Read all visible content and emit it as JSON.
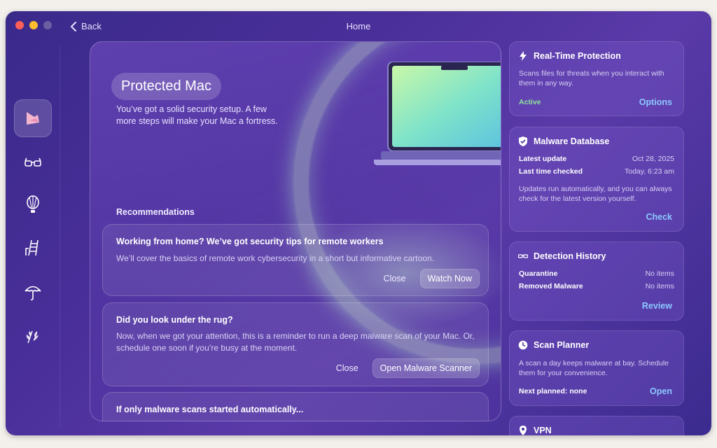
{
  "window": {
    "title": "Home",
    "back_label": "Back"
  },
  "sidebar": {
    "items": [
      {
        "icon": "shield-flag-icon",
        "active": true
      },
      {
        "icon": "glasses-icon"
      },
      {
        "icon": "balloon-icon"
      },
      {
        "icon": "ladder-icon"
      },
      {
        "icon": "umbrella-icon"
      },
      {
        "icon": "leaves-icon"
      }
    ]
  },
  "hero": {
    "title": "Protected Mac",
    "subtitle": "You’ve got a solid security setup. A few more steps will make your Mac a fortress."
  },
  "recommendations": {
    "heading": "Recommendations",
    "items": [
      {
        "title": "Working from home? We’ve got security tips for remote workers",
        "body": "We’ll cover the basics of remote work cybersecurity in a short but informative cartoon.",
        "secondary": "Close",
        "primary": "Watch Now"
      },
      {
        "title": "Did you look under the rug?",
        "body": "Now, when we got your attention, this is a reminder to run a deep malware scan of your Mac. Or, schedule one soon if you’re busy at the moment.",
        "secondary": "Close",
        "primary": "Open Malware Scanner"
      },
      {
        "title": "If only malware scans started automatically..."
      }
    ]
  },
  "cards": {
    "realtime": {
      "title": "Real-Time Protection",
      "desc": "Scans files for threats when you interact with them in any way.",
      "status": "Active",
      "action": "Options"
    },
    "database": {
      "title": "Malware Database",
      "rows": [
        {
          "k": "Latest update",
          "v": "Oct 28, 2025"
        },
        {
          "k": "Last time checked",
          "v": "Today, 6:23 am"
        }
      ],
      "desc": "Updates run automatically, and you can always check for the latest version yourself.",
      "action": "Check"
    },
    "history": {
      "title": "Detection History",
      "rows": [
        {
          "k": "Quarantine",
          "v": "No items"
        },
        {
          "k": "Removed Malware",
          "v": "No items"
        }
      ],
      "action": "Review"
    },
    "planner": {
      "title": "Scan Planner",
      "desc": "A scan a day keeps malware at bay. Schedule them for your convenience.",
      "next": "Next planned: none",
      "action": "Open"
    },
    "vpn": {
      "title": "VPN"
    }
  },
  "colors": {
    "accent_link": "#8cc8ff",
    "status_active": "#8fe39a"
  }
}
